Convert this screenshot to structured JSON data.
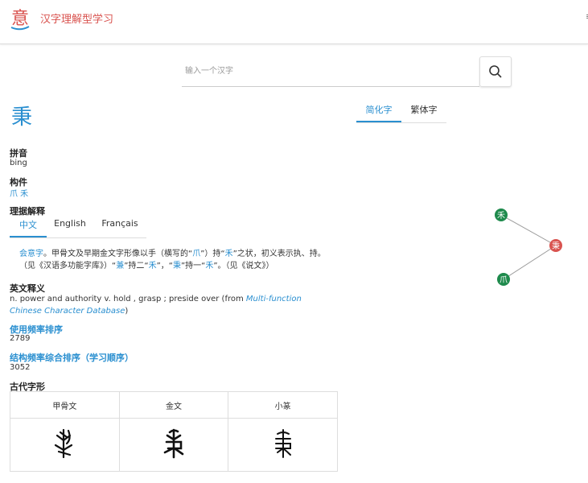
{
  "header": {
    "site_title": "汉字理解型学习",
    "logo_char": "意"
  },
  "search": {
    "placeholder": "输入一个汉字"
  },
  "character": "秉",
  "variant_tabs": [
    "简化字",
    "繁体字"
  ],
  "pinyin": {
    "label": "拼音",
    "value": "bing"
  },
  "components": {
    "label": "构件",
    "value": "爪 禾"
  },
  "etymology": {
    "label": "理据解释",
    "tabs": [
      "中文",
      "English",
      "Français"
    ],
    "text": {
      "type": "会意字",
      "p1": "。甲骨文及早期金文字形像以手（横写的“",
      "claw": "爪",
      "p2": "”）持“",
      "grain": "禾",
      "p3": "”之状，初义表示执、持。（见《汉语多功能字库》）“",
      "jian": "兼",
      "p4": "”持二“",
      "grain2": "禾",
      "p5": "”，“",
      "bing": "秉",
      "p6": "”持一“",
      "grain3": "禾",
      "p7": "”。（见《说文》）"
    }
  },
  "english_definition": {
    "label": "英文释义",
    "text": "n. power and authority v. hold , grasp ; preside over (from ",
    "source": "Multi-function Chinese Character Database",
    "close": ")"
  },
  "frequency": {
    "label": "使用频率排序",
    "value": "2789"
  },
  "structure_frequency": {
    "label": "结构频率综合排序（学习顺序）",
    "value": "3052"
  },
  "ancient_forms": {
    "label": "古代字形",
    "columns": [
      "甲骨文",
      "金文",
      "小篆"
    ]
  },
  "graph": {
    "nodes": [
      "禾",
      "秉",
      "爪"
    ],
    "colors": {
      "component": "#1e8a4c",
      "center": "#d9534f"
    }
  },
  "colors": {
    "accent": "#2a8fd0",
    "brand": "#d9534f"
  }
}
